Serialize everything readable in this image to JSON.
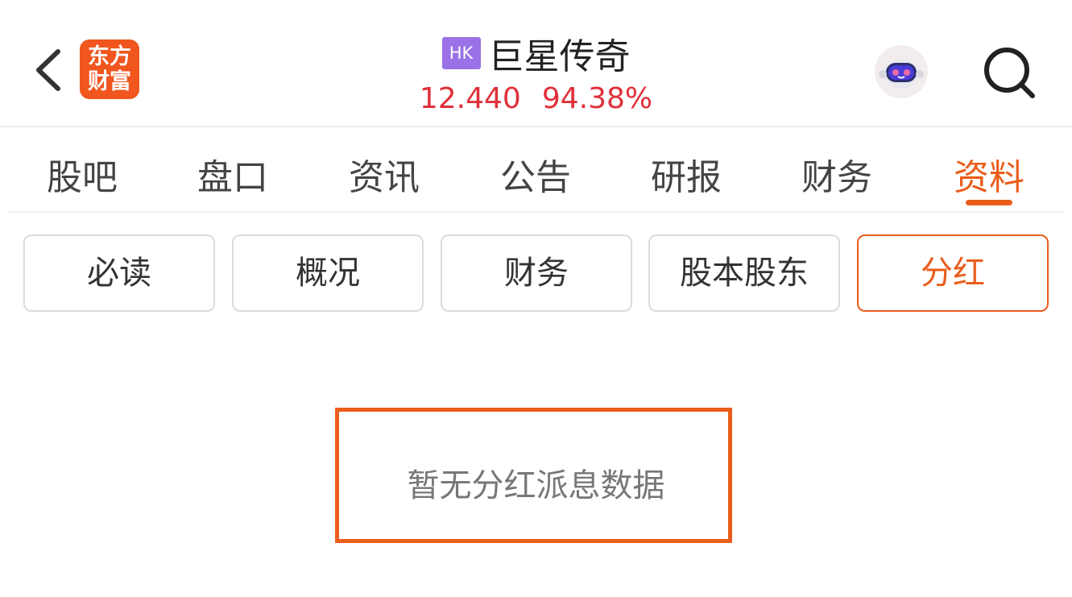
{
  "header": {
    "logo_line1": "东方",
    "logo_line2": "财富",
    "market_badge": "HK",
    "stock_name": "巨星传奇",
    "price": "12.440",
    "change_pct": "94.38%"
  },
  "tabs": [
    {
      "label": "股吧",
      "active": false
    },
    {
      "label": "盘口",
      "active": false
    },
    {
      "label": "资讯",
      "active": false
    },
    {
      "label": "公告",
      "active": false
    },
    {
      "label": "研报",
      "active": false
    },
    {
      "label": "财务",
      "active": false
    },
    {
      "label": "资料",
      "active": true
    }
  ],
  "subtabs": [
    {
      "label": "必读",
      "active": false
    },
    {
      "label": "概况",
      "active": false
    },
    {
      "label": "财务",
      "active": false
    },
    {
      "label": "股本股东",
      "active": false
    },
    {
      "label": "分红",
      "active": true
    }
  ],
  "empty_state": {
    "message": "暂无分红派息数据"
  },
  "colors": {
    "accent": "#ea5d1b",
    "brand": "#f0561d",
    "price_up": "#e0303a",
    "hk_badge": "#9a71e6"
  },
  "icons": {
    "back": "chevron-left-icon",
    "search": "search-icon",
    "assistant": "robot-assistant-icon"
  }
}
